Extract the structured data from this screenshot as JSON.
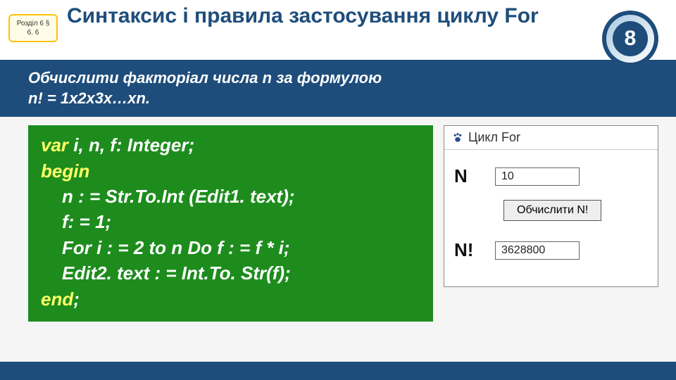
{
  "chapter": {
    "line1": "Розділ 6 §",
    "line2": "6. 6"
  },
  "title": "Синтаксис і правила застосування циклу For",
  "grade": "8",
  "task": {
    "line1": "Обчислити факторіал числа n за формулою",
    "line2": "n! = 1x2x3x…xn."
  },
  "code": {
    "l1_kw": "var",
    "l1_rest": " i, n, f: Integer;",
    "l2": "begin",
    "l3": "n : = Str.To.Int (Edit1. text);",
    "l4": "f: = 1;",
    "l5": "For i : = 2 to n Do f : = f * i;",
    "l6": "Edit2. text : = Int.To. Str(f);",
    "l7_kw": "end",
    "l7_rest": ";"
  },
  "app": {
    "title": "Цикл For",
    "labelN": "N",
    "valueN": "10",
    "button": "Обчислити N!",
    "labelNF": "N!",
    "valueNF": "3628800"
  }
}
